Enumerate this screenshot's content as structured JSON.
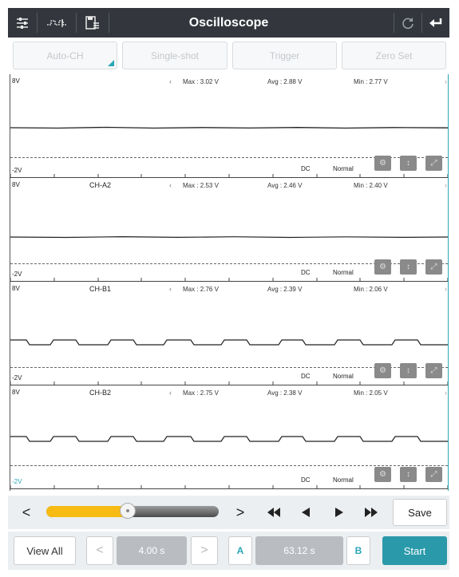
{
  "header": {
    "title": "Oscilloscope"
  },
  "top_buttons": [
    "Auto-CH",
    "Single-shot",
    "Trigger",
    "Zero Set"
  ],
  "channels": [
    {
      "name": "",
      "scale_top": "8V",
      "scale_bottom": "-2V",
      "max": "Max : 3.02 V",
      "avg": "Avg : 2.88 V",
      "min": "Min : 2.77 V",
      "coupling": "DC",
      "mode": "Normal"
    },
    {
      "name": "CH-A2",
      "scale_top": "8V",
      "scale_bottom": "-2V",
      "max": "Max : 2.53 V",
      "avg": "Avg : 2.46 V",
      "min": "Min : 2.40 V",
      "coupling": "DC",
      "mode": "Normal"
    },
    {
      "name": "CH-B1",
      "scale_top": "8V",
      "scale_bottom": "-2V",
      "max": "Max : 2.76 V",
      "avg": "Avg : 2.39 V",
      "min": "Min : 2.06 V",
      "coupling": "DC",
      "mode": "Normal"
    },
    {
      "name": "CH-B2",
      "scale_top": "8V",
      "scale_bottom": "-2V",
      "max": "Max : 2.75 V",
      "avg": "Avg : 2.38 V",
      "min": "Min : 2.05 V",
      "coupling": "DC",
      "mode": "Normal"
    }
  ],
  "slider": {
    "progress": 0.47
  },
  "controls": {
    "prev_label": "<",
    "next_label": ">",
    "save_label": "Save"
  },
  "bottom": {
    "view_all_label": "View All",
    "time_value": "4.00 s",
    "cursor_a_label": "A",
    "cursor_value": "63.12 s",
    "cursor_b_label": "B",
    "start_label": "Start",
    "dec_label": "<",
    "inc_label": ">"
  },
  "colors": {
    "accent": "#2aa6b9",
    "slider_fill": "#f7bb14",
    "titlebar": "#33373d"
  }
}
